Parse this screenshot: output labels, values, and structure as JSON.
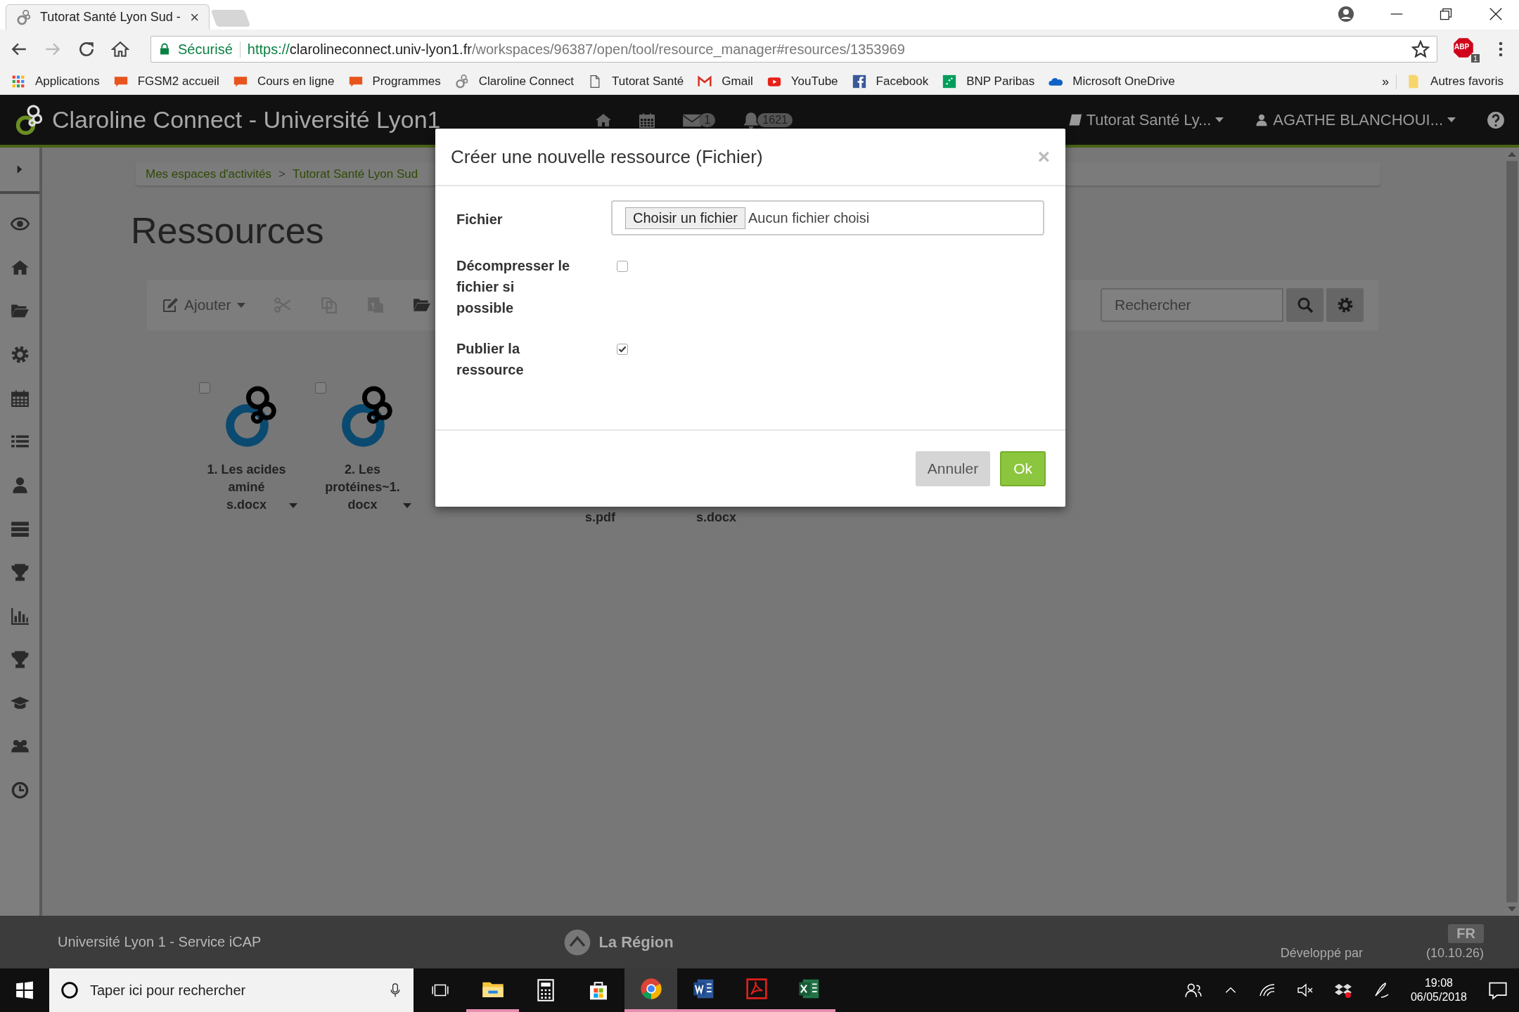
{
  "browser": {
    "tab": {
      "title": "Tutorat Santé Lyon Sud -",
      "close": "×"
    },
    "forward": {
      "disabled": true
    },
    "security": "Sécurisé",
    "url": {
      "scheme": "https://",
      "host": "clarolineconnect.univ-lyon1.fr",
      "path": "/workspaces/96387/open/tool/resource_manager#resources/1353969"
    },
    "extension": {
      "label": "ABP",
      "badge": "1"
    },
    "bookmarks": [
      {
        "label": "Applications"
      },
      {
        "label": "FGSM2 accueil"
      },
      {
        "label": "Cours en ligne"
      },
      {
        "label": "Programmes"
      },
      {
        "label": "Claroline Connect"
      },
      {
        "label": "Tutorat Santé"
      },
      {
        "label": "Gmail"
      },
      {
        "label": "YouTube"
      },
      {
        "label": "Facebook"
      },
      {
        "label": "BNP Paribas"
      },
      {
        "label": "Microsoft OneDrive"
      }
    ],
    "more": "»",
    "other_bookmarks": "Autres favoris"
  },
  "app": {
    "title": "Claroline Connect - Université Lyon1",
    "messages_badge": "1",
    "notifications_badge": "1621",
    "workspace_menu": "Tutorat Santé Ly...",
    "user_menu": "AGATHE BLANCHOUI..."
  },
  "breadcrumb": {
    "items": [
      "Mes espaces d'activités",
      "Tutorat Santé Lyon Sud"
    ],
    "separator": ">"
  },
  "page_title": "Ressources",
  "toolbar": {
    "add": "Ajouter",
    "search": {
      "placeholder": "Rechercher"
    }
  },
  "resources": [
    {
      "kind": "file",
      "lines": [
        "1. Les acides",
        "aminé",
        "s.docx"
      ],
      "checked": false
    },
    {
      "kind": "file",
      "lines": [
        "2. Les",
        "protéines~1.",
        "docx"
      ],
      "checked": false
    },
    {
      "kind": "covered"
    },
    {
      "kind": "partial",
      "lines": [
        "s.pdf"
      ]
    },
    {
      "kind": "partial",
      "lines": [
        "s.docx"
      ]
    }
  ],
  "modal": {
    "title": "Créer une nouvelle ressource (Fichier)",
    "close": "×",
    "fields": [
      {
        "kind": "file",
        "label": "Fichier",
        "button": "Choisir un fichier",
        "value": "Aucun fichier choisi"
      },
      {
        "kind": "checkbox",
        "label": "Décompresser le fichier si possible",
        "checked": false
      },
      {
        "kind": "checkbox",
        "label": "Publier la ressource",
        "checked": true
      }
    ],
    "buttons": [
      {
        "kind": "secondary",
        "label": "Annuler"
      },
      {
        "kind": "primary",
        "label": "Ok"
      }
    ]
  },
  "footer": {
    "text": "Université Lyon 1 - Service iCAP",
    "partner": "La Région",
    "credit": "Développé par",
    "version": "(10.10.26)",
    "language": "FR"
  },
  "taskbar": {
    "search": {
      "placeholder": "Taper ici pour rechercher"
    },
    "apps": [
      {
        "running": true,
        "selected": false
      },
      {
        "running": false,
        "selected": false
      },
      {
        "running": false,
        "selected": false
      },
      {
        "running": true,
        "selected": true
      },
      {
        "running": true,
        "selected": false
      },
      {
        "running": true,
        "selected": false
      },
      {
        "running": true,
        "selected": false
      }
    ],
    "clock": {
      "time": "19:08",
      "date": "06/05/2018"
    }
  }
}
